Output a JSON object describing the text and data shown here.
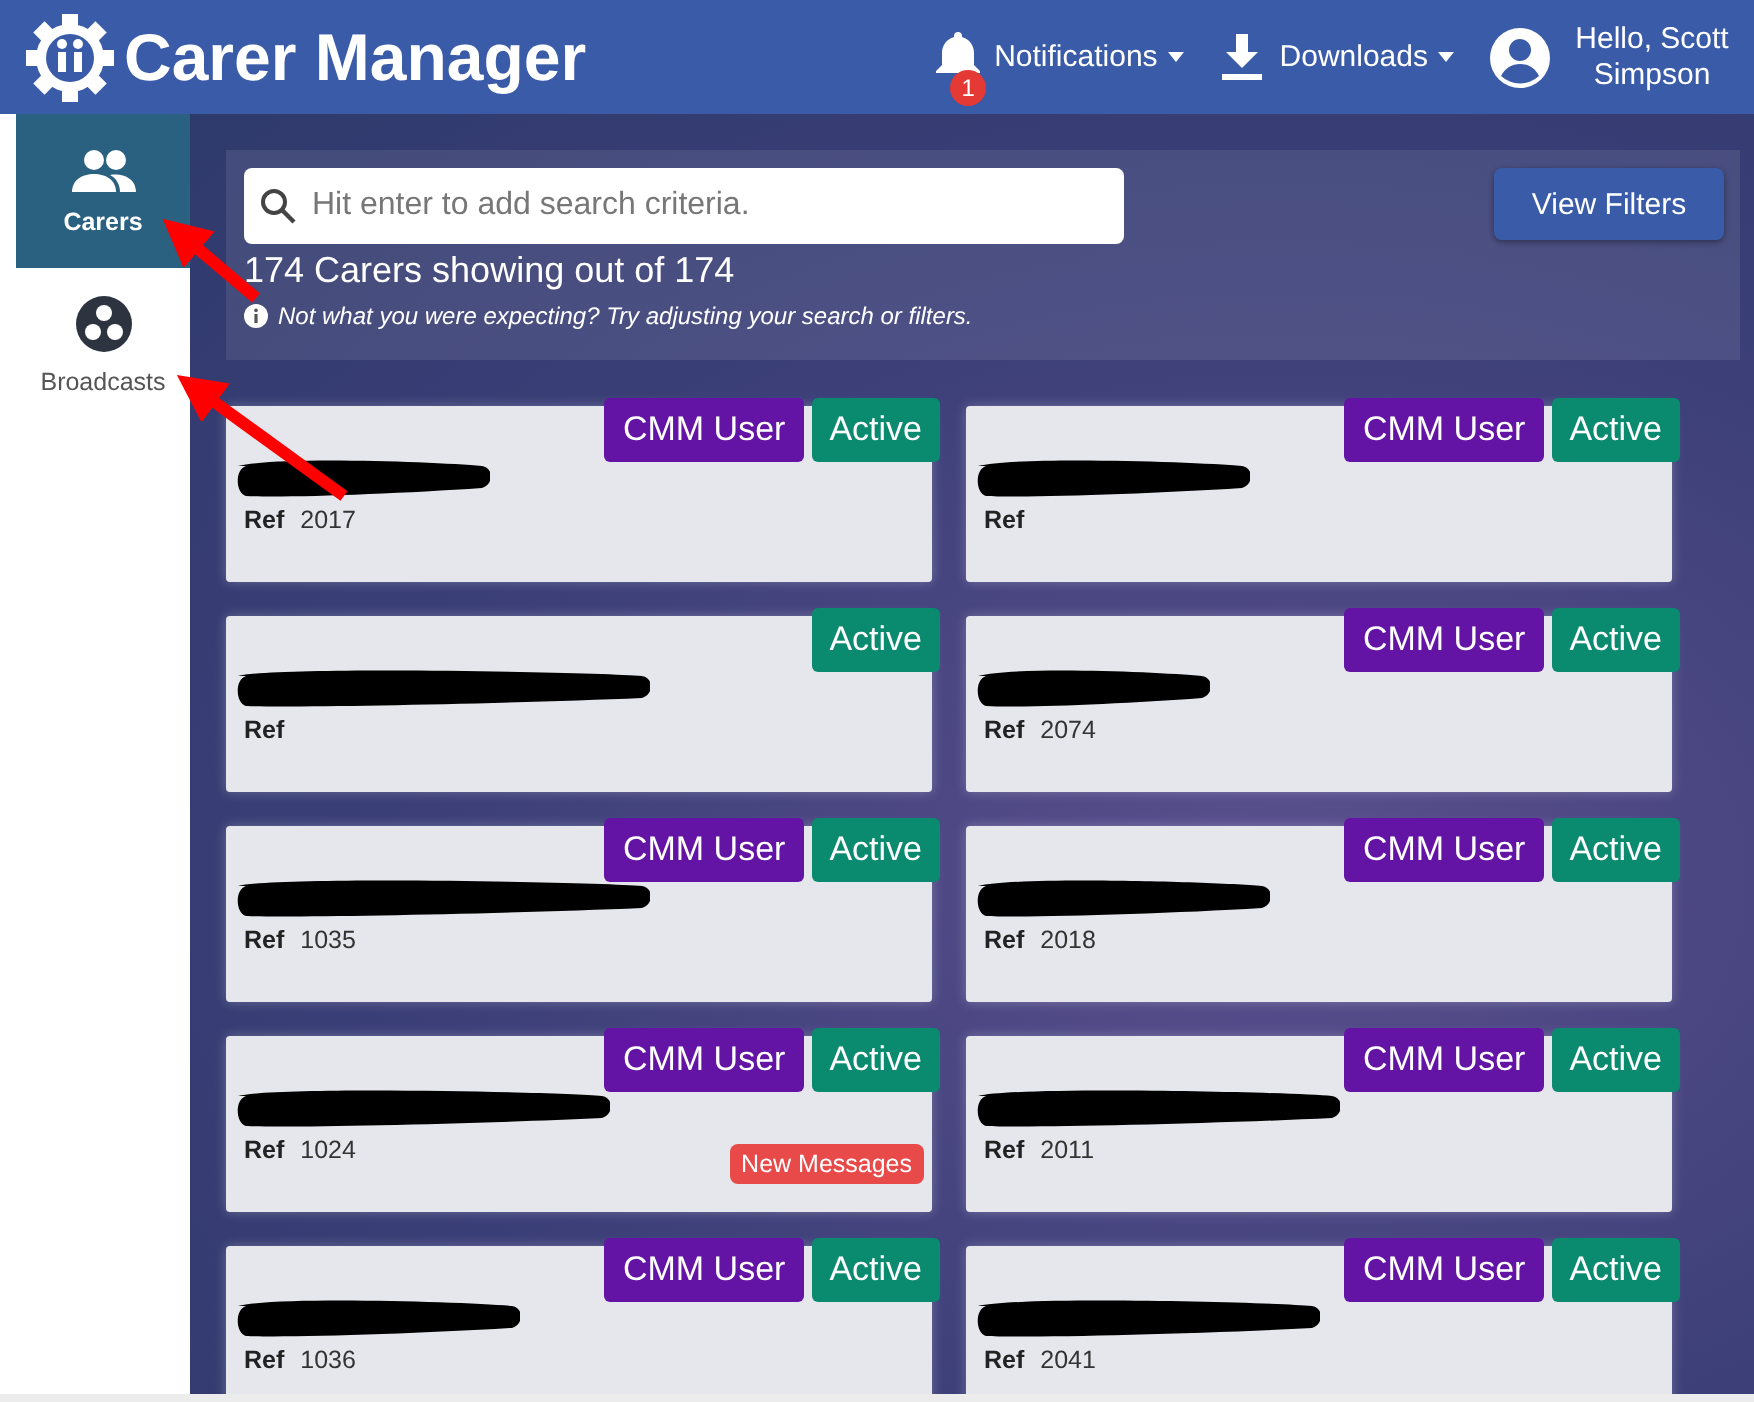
{
  "header": {
    "title": "Carer Manager",
    "notifications": {
      "label": "Notifications",
      "count": "1"
    },
    "downloads": {
      "label": "Downloads"
    },
    "greeting": "Hello, Scott Simpson"
  },
  "sidebar": {
    "items": [
      {
        "kind": "people",
        "label": "Carers",
        "selected": true
      },
      {
        "kind": "broadcast",
        "label": "Broadcasts",
        "selected": false
      }
    ]
  },
  "filters": {
    "search": {
      "placeholder": "Hit enter to add search criteria."
    },
    "button": "View Filters",
    "count_text": "174 Carers showing out of 174",
    "hint": "Not what you were expecting? Try adjusting your search or filters."
  },
  "cards": [
    {
      "ref_label": "Ref",
      "ref": "2017",
      "badges": [
        {
          "kind": "cmm",
          "label": "CMM User"
        },
        {
          "kind": "active",
          "label": "Active"
        }
      ]
    },
    {
      "ref_label": "Ref",
      "badges": [
        {
          "kind": "cmm",
          "label": "CMM User"
        },
        {
          "kind": "active",
          "label": "Active"
        }
      ]
    },
    {
      "ref_label": "Ref",
      "badges": [
        {
          "kind": "active",
          "label": "Active"
        }
      ]
    },
    {
      "ref_label": "Ref",
      "ref": "2074",
      "badges": [
        {
          "kind": "cmm",
          "label": "CMM User"
        },
        {
          "kind": "active",
          "label": "Active"
        }
      ]
    },
    {
      "ref_label": "Ref",
      "ref": "1035",
      "badges": [
        {
          "kind": "cmm",
          "label": "CMM User"
        },
        {
          "kind": "active",
          "label": "Active"
        }
      ]
    },
    {
      "ref_label": "Ref",
      "ref": "2018",
      "badges": [
        {
          "kind": "cmm",
          "label": "CMM User"
        },
        {
          "kind": "active",
          "label": "Active"
        }
      ]
    },
    {
      "ref_label": "Ref",
      "ref": "1024",
      "badges": [
        {
          "kind": "cmm",
          "label": "CMM User"
        },
        {
          "kind": "active",
          "label": "Active"
        }
      ],
      "alert": "New Messages"
    },
    {
      "ref_label": "Ref",
      "ref": "2011",
      "badges": [
        {
          "kind": "cmm",
          "label": "CMM User"
        },
        {
          "kind": "active",
          "label": "Active"
        }
      ]
    },
    {
      "ref_label": "Ref",
      "ref": "1036",
      "badges": [
        {
          "kind": "cmm",
          "label": "CMM User"
        },
        {
          "kind": "active",
          "label": "Active"
        }
      ]
    },
    {
      "ref_label": "Ref",
      "ref": "2041",
      "badges": [
        {
          "kind": "cmm",
          "label": "CMM User"
        },
        {
          "kind": "active",
          "label": "Active"
        }
      ]
    }
  ]
}
